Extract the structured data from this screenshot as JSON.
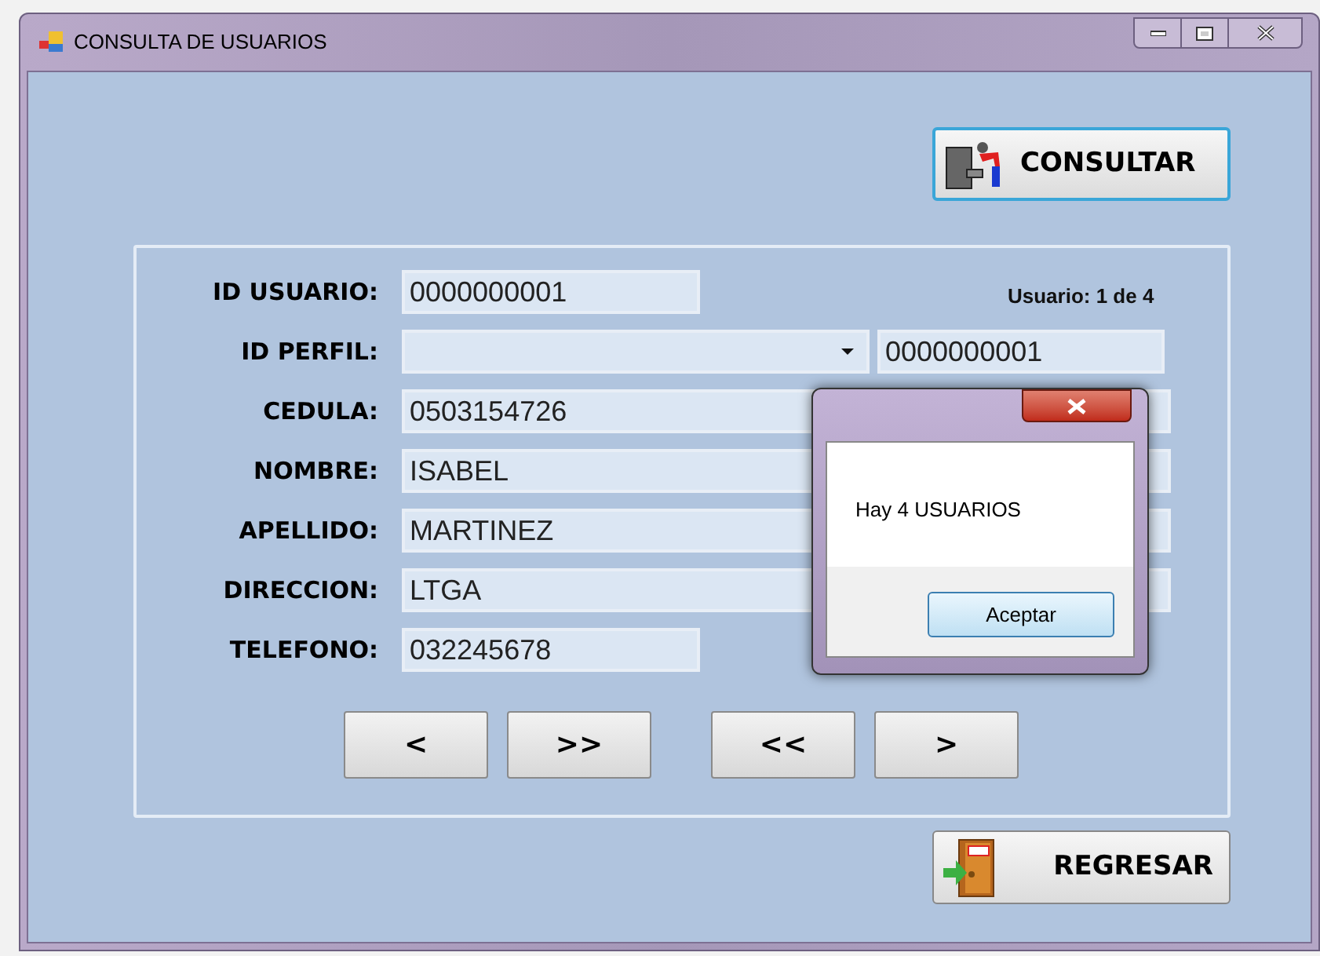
{
  "window": {
    "title": "CONSULTA DE USUARIOS"
  },
  "consult_button": {
    "label": "CONSULTAR"
  },
  "record_counter": "Usuario: 1 de 4",
  "fields": [
    {
      "label": "ID USUARIO:",
      "value": "0000000001",
      "kind": "short"
    },
    {
      "label": "ID PERFIL:",
      "kind": "combo",
      "extra_value": "0000000001"
    },
    {
      "label": "CEDULA:",
      "value": "0503154726",
      "kind": "long"
    },
    {
      "label": "NOMBRE:",
      "value": "ISABEL",
      "kind": "long"
    },
    {
      "label": "APELLIDO:",
      "value": "MARTINEZ",
      "kind": "long"
    },
    {
      "label": "DIRECCION:",
      "value": "LTGA",
      "kind": "long"
    },
    {
      "label": "TELEFONO:",
      "value": "032245678",
      "kind": "short"
    }
  ],
  "nav_buttons": [
    "<",
    ">>",
    "<<",
    ">"
  ],
  "back_button": {
    "label": "REGRESAR"
  },
  "dialog": {
    "message": "Hay 4 USUARIOS",
    "button": "Aceptar"
  }
}
